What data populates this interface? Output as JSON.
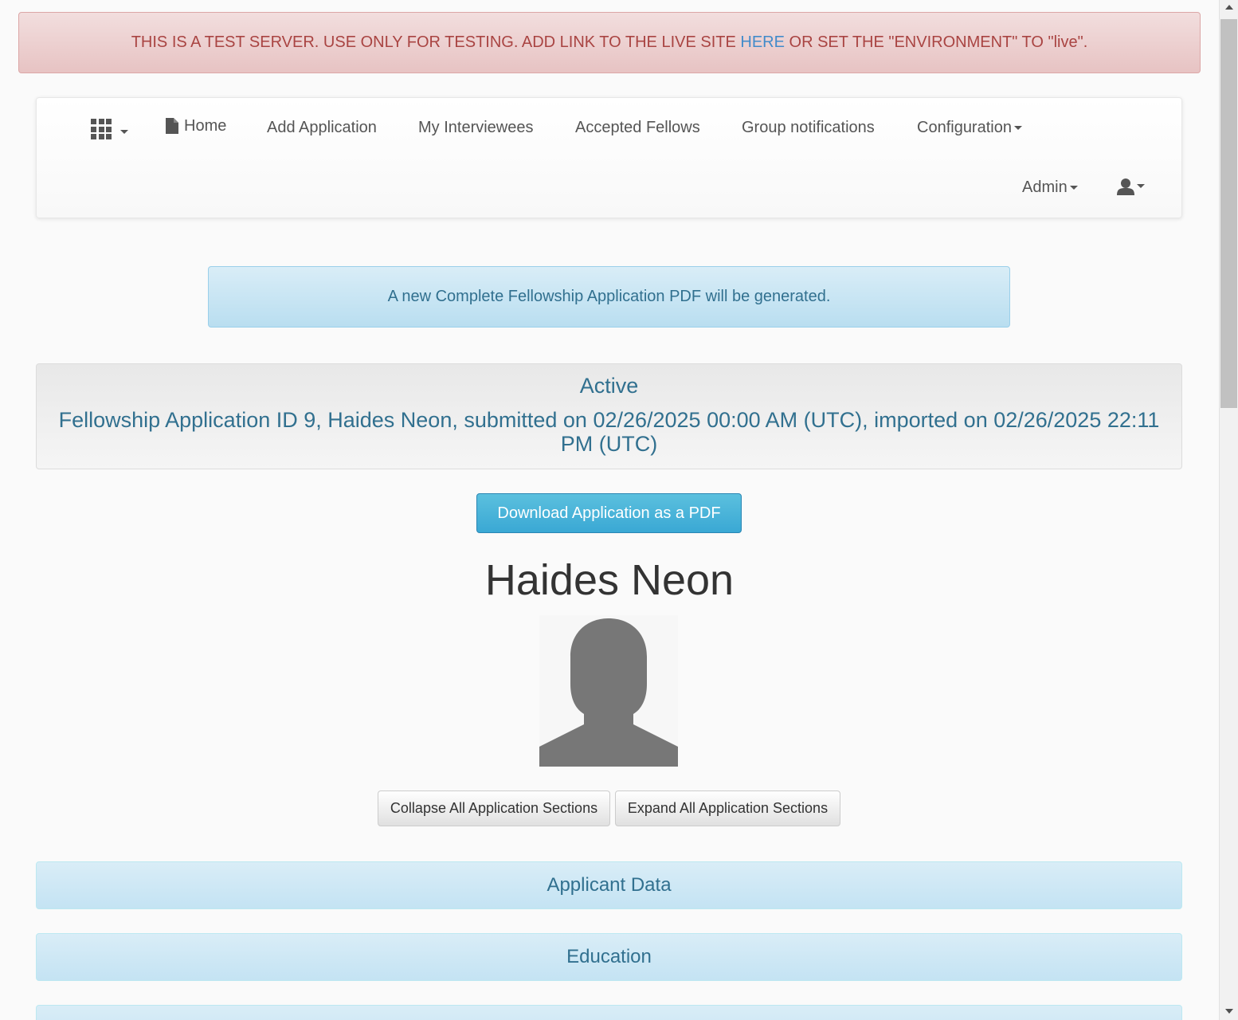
{
  "banner": {
    "text_before": "THIS IS A TEST SERVER. USE ONLY FOR TESTING.  ADD LINK TO THE LIVE SITE ",
    "link_label": "HERE",
    "text_after": " OR SET THE \"ENVIRONMENT\" TO \"live\"."
  },
  "navbar": {
    "apps_icon": "grid-icon",
    "home_label": "Home",
    "home_icon": "file-icon",
    "items": [
      "Add Application",
      "My Interviewees",
      "Accepted Fellows",
      "Group notifications"
    ],
    "configuration_label": "Configuration",
    "admin_label": "Admin",
    "user_icon": "user-icon"
  },
  "alert": {
    "text": "A new Complete Fellowship Application PDF will be generated."
  },
  "status": {
    "label": "Active",
    "application_line": "Fellowship Application ID 9, Haides Neon, submitted on 02/26/2025 00:00 AM (UTC), imported on 02/26/2025 22:11 PM (UTC)"
  },
  "actions": {
    "download_label": "Download Application as a PDF",
    "collapse_label": "Collapse All Application Sections",
    "expand_label": "Expand All Application Sections"
  },
  "applicant": {
    "name": "Haides Neon"
  },
  "sections": [
    "Applicant Data",
    "Education",
    ""
  ],
  "colors": {
    "banner_text": "#a94442",
    "link": "#428bca",
    "info_text": "#31708f",
    "primary_button": "#5bc0de"
  }
}
